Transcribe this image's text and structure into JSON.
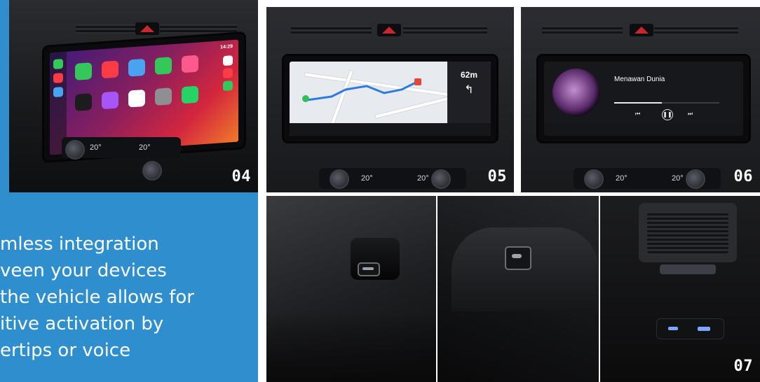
{
  "tiles": {
    "carplay": {
      "number": "04",
      "time": "14:29"
    },
    "navigation": {
      "number": "05",
      "distance": "62m"
    },
    "media": {
      "number": "06",
      "song_title": "Menawan Dunia"
    },
    "ports": {
      "number": "07"
    }
  },
  "carplay_apps": [
    {
      "name": "phone-app",
      "color": "#34c759"
    },
    {
      "name": "music-app",
      "color": "#fc3c44"
    },
    {
      "name": "maps-app",
      "color": "#4aa3f0"
    },
    {
      "name": "messages-app",
      "color": "#34c759"
    },
    {
      "name": "now-playing-app",
      "color": "#fc5a8d"
    },
    {
      "name": "audiobook-app",
      "color": "#1c1c1e"
    },
    {
      "name": "podcasts-app",
      "color": "#a855f7"
    },
    {
      "name": "calendar-app",
      "color": "#ffffff"
    },
    {
      "name": "settings-app",
      "color": "#8e8e93"
    },
    {
      "name": "whatsapp-app",
      "color": "#25d366"
    }
  ],
  "climate": {
    "left_temp": "20°",
    "right_temp": "20°"
  },
  "description": {
    "lines": [
      "mless integration",
      "veen your devices",
      " the vehicle allows for",
      "itive activation by",
      "ertips or voice"
    ]
  },
  "colors": {
    "panel_blue": "#2f8fce",
    "hazard_red": "#c8282b"
  }
}
